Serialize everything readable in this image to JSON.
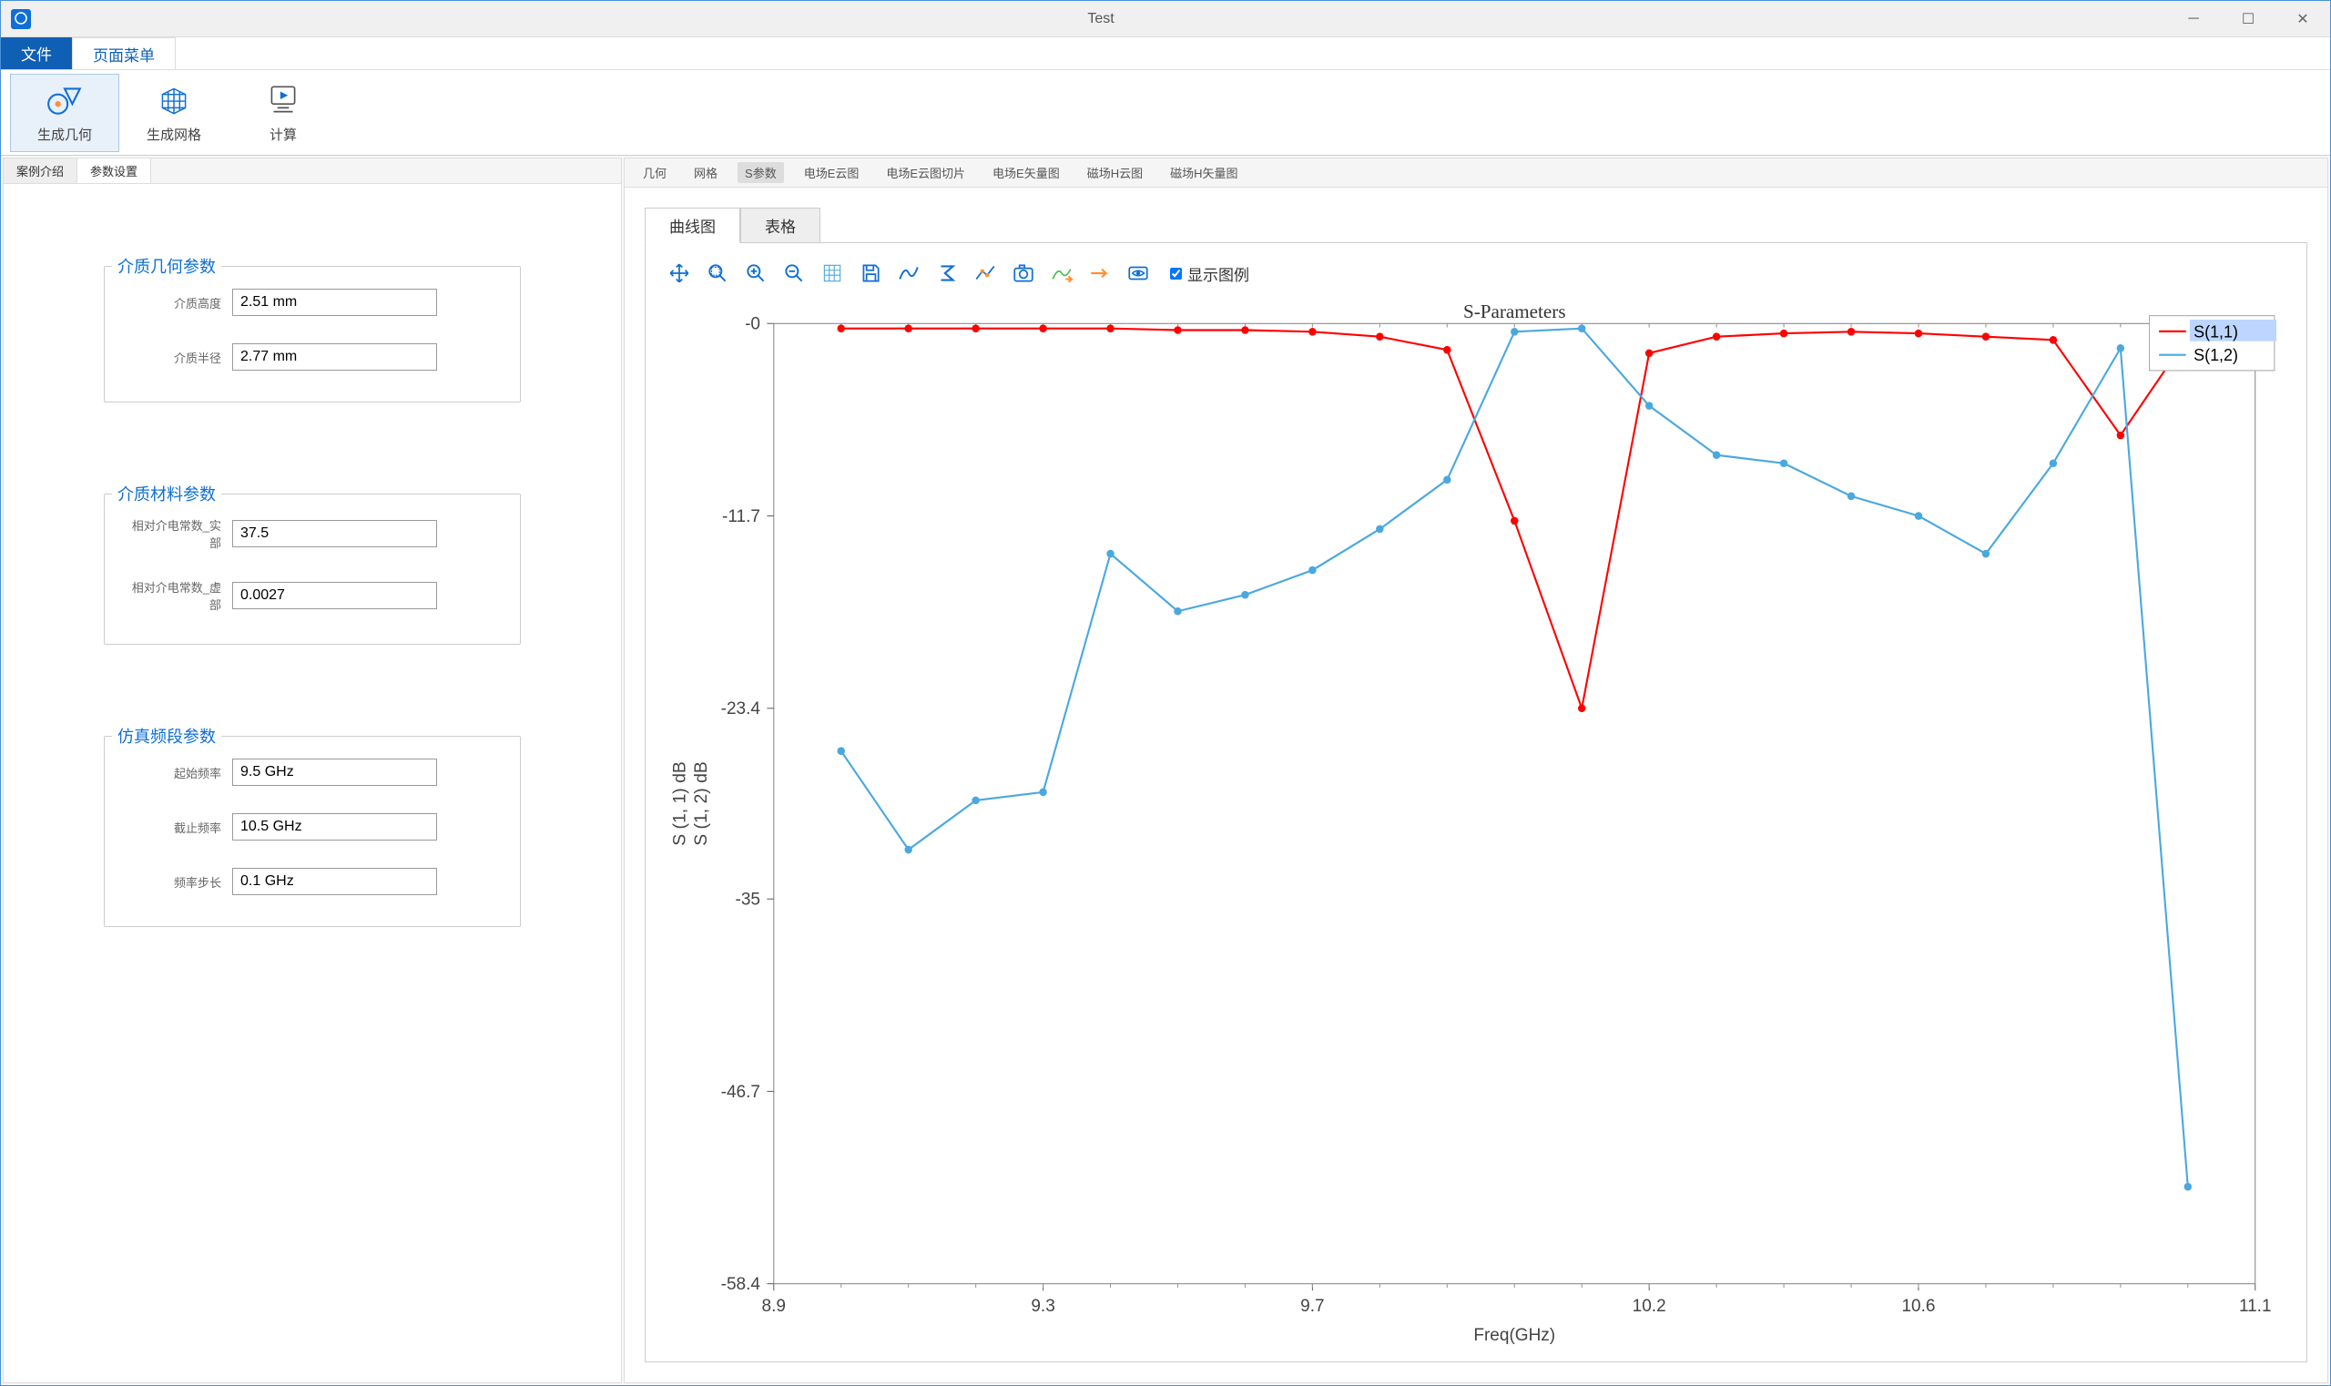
{
  "window": {
    "title": "Test"
  },
  "menu": {
    "file": "文件",
    "page": "页面菜单"
  },
  "ribbon": {
    "gen_geom": "生成几何",
    "gen_mesh": "生成网格",
    "compute": "计算"
  },
  "left_tabs": {
    "intro": "案例介绍",
    "params": "参数设置"
  },
  "groups": {
    "geom": {
      "title": "介质几何参数",
      "height_label": "介质高度",
      "height_value": "2.51 mm",
      "radius_label": "介质半径",
      "radius_value": "2.77 mm"
    },
    "material": {
      "title": "介质材料参数",
      "eps_re_label": "相对介电常数_实部",
      "eps_re_value": "37.5",
      "eps_im_label": "相对介电常数_虚部",
      "eps_im_value": "0.0027"
    },
    "freq": {
      "title": "仿真频段参数",
      "start_label": "起始频率",
      "start_value": "9.5 GHz",
      "stop_label": "截止频率",
      "stop_value": "10.5 GHz",
      "step_label": "频率步长",
      "step_value": "0.1 GHz"
    }
  },
  "view_tabs": [
    "几何",
    "网格",
    "S参数",
    "电场E云图",
    "电场E云图切片",
    "电场E矢量图",
    "磁场H云图",
    "磁场H矢量图"
  ],
  "view_active": "S参数",
  "chart_tabs": {
    "line": "曲线图",
    "table": "表格"
  },
  "legend_label": "显示图例",
  "chart_data": {
    "type": "line",
    "title": "S-Parameters",
    "xlabel": "Freq(GHz)",
    "ylabel": "S (1, 1) dB\nS (1, 2) dB",
    "xlim": [
      8.9,
      11.1
    ],
    "ylim": [
      -58.4,
      0
    ],
    "xticks": [
      8.9,
      9.3,
      9.7,
      10.2,
      10.6,
      11.1
    ],
    "yticks": [
      0,
      -11.7,
      -23.4,
      -35,
      -46.7,
      -58.4
    ],
    "x": [
      9.0,
      9.1,
      9.2,
      9.3,
      9.4,
      9.5,
      9.6,
      9.7,
      9.8,
      9.9,
      10.0,
      10.1,
      10.2,
      10.3,
      10.4,
      10.5,
      10.6,
      10.7,
      10.8,
      10.9,
      11.0
    ],
    "series": [
      {
        "name": "S(1,1)",
        "color": "#ff0000",
        "values": [
          -0.3,
          -0.3,
          -0.3,
          -0.3,
          -0.3,
          -0.4,
          -0.4,
          -0.5,
          -0.8,
          -1.6,
          -12.0,
          -23.4,
          -1.8,
          -0.8,
          -0.6,
          -0.5,
          -0.6,
          -0.8,
          -1.0,
          -6.8,
          -0.8
        ]
      },
      {
        "name": "S(1,2)",
        "color": "#4aa8e0",
        "values": [
          -26.0,
          -32.0,
          -29.0,
          -28.5,
          -14.0,
          -17.5,
          -16.5,
          -15.0,
          -12.5,
          -9.5,
          -0.5,
          -0.3,
          -5.0,
          -8.0,
          -8.5,
          -10.5,
          -11.7,
          -14.0,
          -8.5,
          -1.5,
          -52.5
        ]
      }
    ]
  }
}
